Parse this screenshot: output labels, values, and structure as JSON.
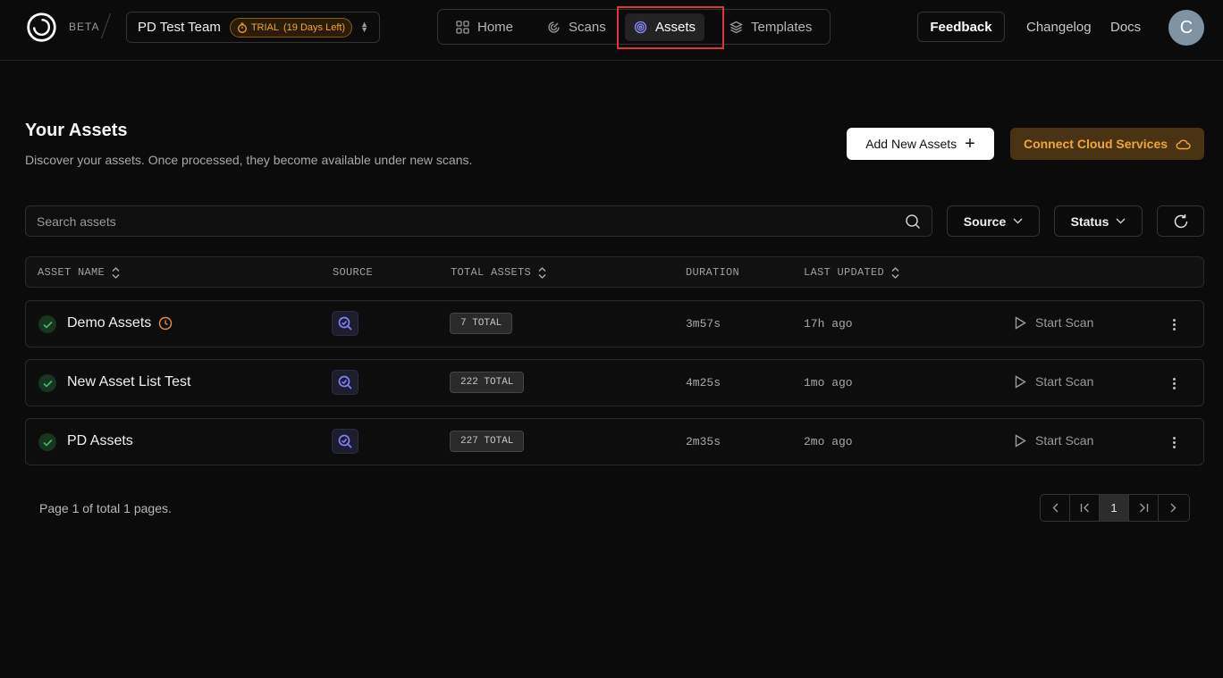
{
  "header": {
    "beta_label": "BETA",
    "team_name": "PD Test Team",
    "trial_label": "TRIAL",
    "trial_days": "(19 Days Left)",
    "nav": [
      {
        "label": "Home",
        "icon": "grid-icon"
      },
      {
        "label": "Scans",
        "icon": "radar-icon"
      },
      {
        "label": "Assets",
        "icon": "target-icon",
        "active": true
      },
      {
        "label": "Templates",
        "icon": "layers-icon"
      }
    ],
    "feedback_label": "Feedback",
    "changelog_label": "Changelog",
    "docs_label": "Docs",
    "avatar_initial": "C"
  },
  "page": {
    "title": "Your Assets",
    "subtitle": "Discover your assets. Once processed, they become available under new scans.",
    "add_button": "Add New Assets",
    "cloud_button": "Connect Cloud Services"
  },
  "toolbar": {
    "search_placeholder": "Search assets",
    "source_filter": "Source",
    "status_filter": "Status"
  },
  "table": {
    "columns": {
      "asset_name": "ASSET NAME",
      "source": "SOURCE",
      "total_assets": "TOTAL ASSETS",
      "duration": "DURATION",
      "last_updated": "LAST UPDATED"
    },
    "rows": [
      {
        "name": "Demo Assets",
        "total": "7 TOTAL",
        "duration": "3m57s",
        "updated": "17h ago",
        "action": "Start Scan",
        "status": "completed",
        "scheduled": true
      },
      {
        "name": "New Asset List Test",
        "total": "222 TOTAL",
        "duration": "4m25s",
        "updated": "1mo ago",
        "action": "Start Scan",
        "status": "completed",
        "scheduled": false
      },
      {
        "name": "PD Assets",
        "total": "227 TOTAL",
        "duration": "2m35s",
        "updated": "2mo ago",
        "action": "Start Scan",
        "status": "completed",
        "scheduled": false
      }
    ]
  },
  "pagination": {
    "info": "Page 1 of total 1 pages.",
    "current_page": "1"
  },
  "colors": {
    "background": "#0b0b0b",
    "accent_orange": "#f0a53a",
    "success_green": "#3fb968",
    "source_purple": "#7b7bf5",
    "highlight_red": "#d8373b"
  }
}
